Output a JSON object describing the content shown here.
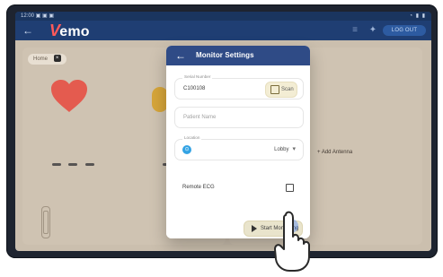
{
  "status_bar": {
    "left": "12:00 ▣ ▣ ▣",
    "right": "◔ ▮ ▮"
  },
  "app": {
    "logo_letter": "V",
    "logo_text": "emo",
    "header_button_label": "LOG OUT"
  },
  "background": {
    "home_pill_label": "Home",
    "home_pill_x": "×",
    "add_antenna_label": "+ Add Antenna"
  },
  "modal": {
    "title": "Monitor Settings",
    "serial_field": {
      "label": "Serial Number",
      "value": "C100108",
      "scan_label": "Scan"
    },
    "patient_field": {
      "placeholder": "Patient Name"
    },
    "location_field": {
      "label": "Location",
      "value": "Lobby"
    },
    "check_row": {
      "label": "Remote ECG"
    },
    "start_button": {
      "label": "Start Monitoring"
    }
  },
  "colors": {
    "app_bar": "#1f3e73",
    "modal_header": "#2f4b86",
    "accent_blue": "#2c6fff",
    "heart_red": "#e45b4f",
    "bubble_gold": "#d6a22c",
    "button_beige": "#e9e4cc"
  },
  "icons": {
    "back": "back-arrow-icon",
    "menu": "menu-icon",
    "gear": "gear-icon",
    "scan": "scan-icon",
    "location": "location-icon",
    "chevron_down": "chevron-down-icon",
    "checkbox": "checkbox-icon",
    "play": "play-icon",
    "heart": "heart-icon",
    "hand": "hand-pointer-icon"
  }
}
